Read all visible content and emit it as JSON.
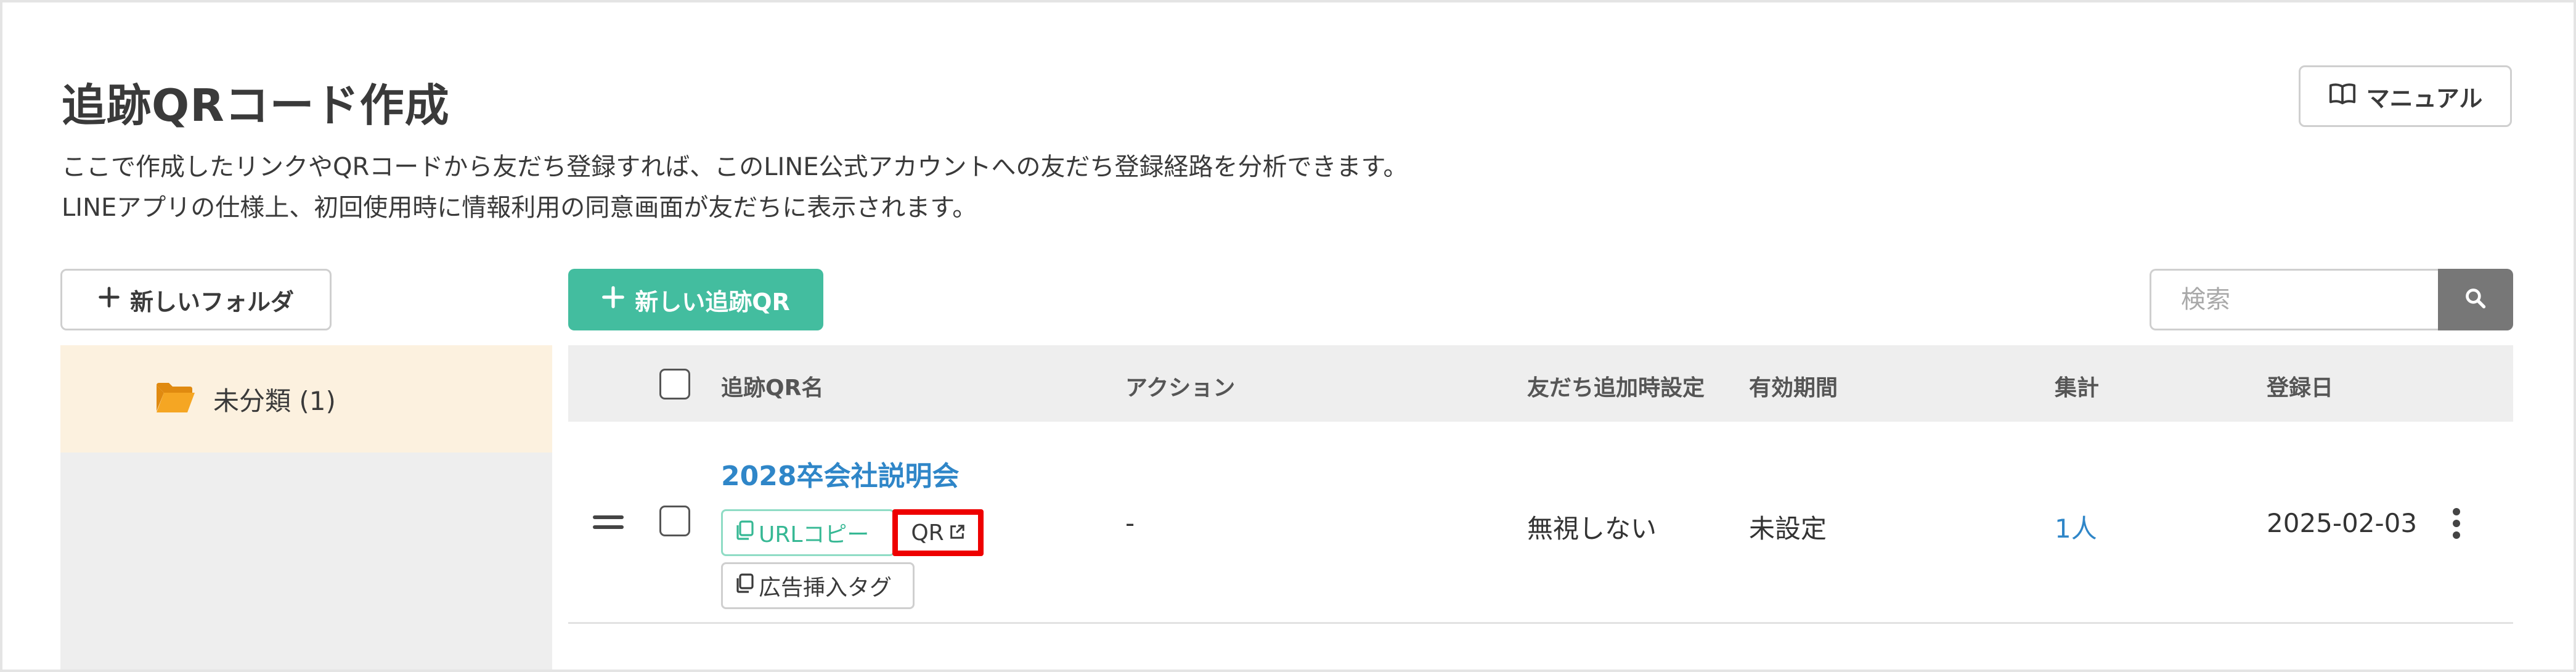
{
  "header": {
    "title": "追跡QRコード作成",
    "description_line1": "ここで作成したリンクやQRコードから友だち登録すれば、このLINE公式アカウントへの友だち登録経路を分析できます。",
    "description_line2": "LINEアプリの仕様上、初回使用時に情報利用の同意画面が友だちに表示されます。",
    "manual_label": "マニュアル",
    "manual_icon": "book-icon"
  },
  "toolbar": {
    "new_folder_label": "新しいフォルダ",
    "new_qr_label": "新しい追跡QR",
    "search_placeholder": "検索",
    "search_value": "",
    "search_icon": "magnifier-icon"
  },
  "sidebar": {
    "folders": [
      {
        "label": "未分類 (1)",
        "selected": true,
        "icon": "folder-open-icon"
      }
    ]
  },
  "table": {
    "columns": [
      "追跡QR名",
      "アクション",
      "友だち追加時設定",
      "有効期間",
      "集計",
      "登録日"
    ],
    "rows": [
      {
        "name": "2028卒会社説明会",
        "url_copy_label": "URLコピー",
        "qr_label": "QR",
        "ad_tag_label": "広告挿入タグ",
        "action": "-",
        "friend_setting": "無視しない",
        "period": "未設定",
        "count": "1人",
        "registered": "2025-02-03"
      }
    ]
  },
  "colors": {
    "accent_green": "#43bd9f",
    "link_blue": "#2f86c8",
    "highlight_red": "#ee0000",
    "folder_orange": "#f0a020"
  }
}
